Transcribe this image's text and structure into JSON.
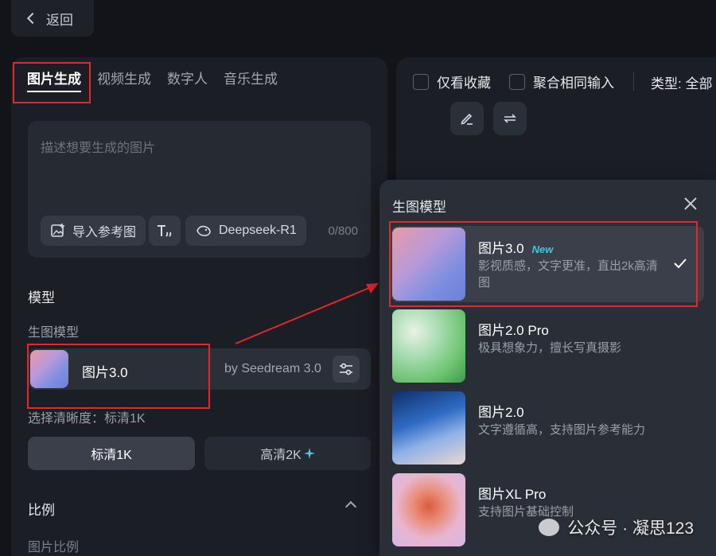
{
  "back": {
    "label": "返回"
  },
  "tabs": [
    {
      "label": "图片生成",
      "active": true
    },
    {
      "label": "视频生成",
      "active": false
    },
    {
      "label": "数字人",
      "active": false
    },
    {
      "label": "音乐生成",
      "active": false
    }
  ],
  "prompt": {
    "placeholder": "描述想要生成的图片",
    "import_label": "导入参考图",
    "deepseek_label": "Deepseek-R1",
    "counter": "0/800"
  },
  "model_section": {
    "title": "模型",
    "subtitle": "生图模型",
    "selected_name": "图片3.0",
    "selected_by": "by Seedream 3.0"
  },
  "resolution": {
    "label": "选择清晰度：标清1K",
    "options": [
      {
        "label": "标清1K",
        "active": true
      },
      {
        "label": "高清2K",
        "active": false
      }
    ]
  },
  "ratio": {
    "title": "比例"
  },
  "bottom_left_partial": "图片比例",
  "right_toolbar": {
    "fav_label": "仅看收藏",
    "merge_label": "聚合相同输入",
    "type_label": "类型: 全部"
  },
  "popup": {
    "title": "生图模型",
    "models": [
      {
        "name": "图片3.0",
        "badge": "New",
        "desc": "影视质感，文字更准，直出2k高清图",
        "selected": true
      },
      {
        "name": "图片2.0 Pro",
        "badge": "",
        "desc": "极具想象力，擅长写真摄影",
        "selected": false
      },
      {
        "name": "图片2.0",
        "badge": "",
        "desc": "文字遵循高，支持图片参考能力",
        "selected": false
      },
      {
        "name": "图片XL Pro",
        "badge": "",
        "desc": "支持图片基础控制",
        "selected": false
      }
    ]
  },
  "watermark": "公众号 · 凝思123",
  "colors": {
    "highlight_red": "#e5262a",
    "new_badge": "#3fc7e0",
    "sparkle": "#4fc8e8"
  },
  "icons": [
    "chevron-left-icon",
    "image-add-icon",
    "text-format-icon",
    "deepseek-whale-icon",
    "sliders-icon",
    "edit-icon",
    "repeat-icon",
    "close-icon",
    "check-icon",
    "sparkle-icon",
    "chevron-up-icon",
    "wechat-icon"
  ]
}
